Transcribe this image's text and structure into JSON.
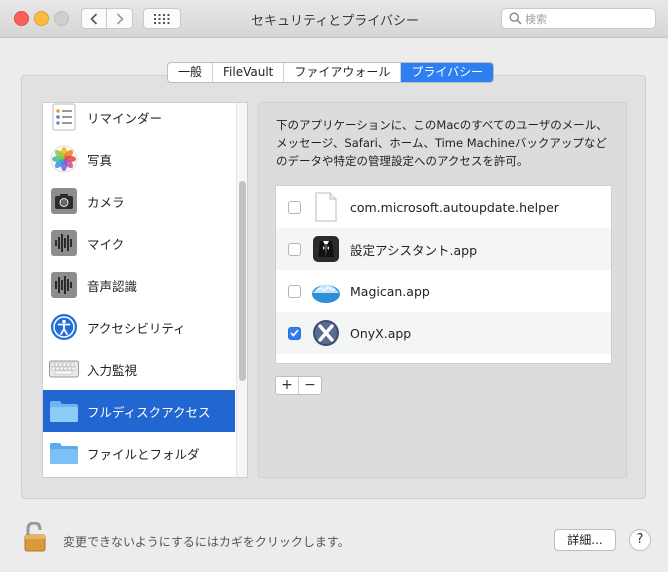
{
  "window": {
    "title": "セキュリティとプライバシー",
    "search_placeholder": "検索"
  },
  "tabs": [
    {
      "label": "一般",
      "active": false
    },
    {
      "label": "FileVault",
      "active": false
    },
    {
      "label": "ファイアウォール",
      "active": false
    },
    {
      "label": "プライバシー",
      "active": true
    }
  ],
  "sidebar": {
    "items": [
      {
        "label": "リマインダー",
        "icon": "reminders-icon"
      },
      {
        "label": "写真",
        "icon": "photos-icon"
      },
      {
        "label": "カメラ",
        "icon": "camera-icon"
      },
      {
        "label": "マイク",
        "icon": "microphone-icon"
      },
      {
        "label": "音声認識",
        "icon": "speech-recognition-icon"
      },
      {
        "label": "アクセシビリティ",
        "icon": "accessibility-icon"
      },
      {
        "label": "入力監視",
        "icon": "keyboard-icon"
      },
      {
        "label": "フルディスクアクセス",
        "icon": "folder-icon",
        "selected": true
      },
      {
        "label": "ファイルとフォルダ",
        "icon": "folder-icon"
      }
    ]
  },
  "content": {
    "description": "下のアプリケーションに、このMacのすべてのユーザのメール、メッセージ、Safari、ホーム、Time Machineバックアップなどのデータや特定の管理設定へのアクセスを許可。",
    "apps": [
      {
        "name": "com.microsoft.autoupdate.helper",
        "checked": false,
        "icon": "document-icon"
      },
      {
        "name": "設定アシスタント.app",
        "checked": false,
        "icon": "setup-assistant-icon"
      },
      {
        "name": "Magican.app",
        "checked": false,
        "icon": "magican-icon"
      },
      {
        "name": "OnyX.app",
        "checked": true,
        "icon": "onyx-icon"
      }
    ],
    "add_label": "+",
    "remove_label": "−"
  },
  "footer": {
    "lock_text": "変更できないようにするにはカギをクリックします。",
    "details_label": "詳細...",
    "help_label": "?"
  },
  "colors": {
    "accent": "#2e7ff2",
    "selection": "#2266d1"
  }
}
